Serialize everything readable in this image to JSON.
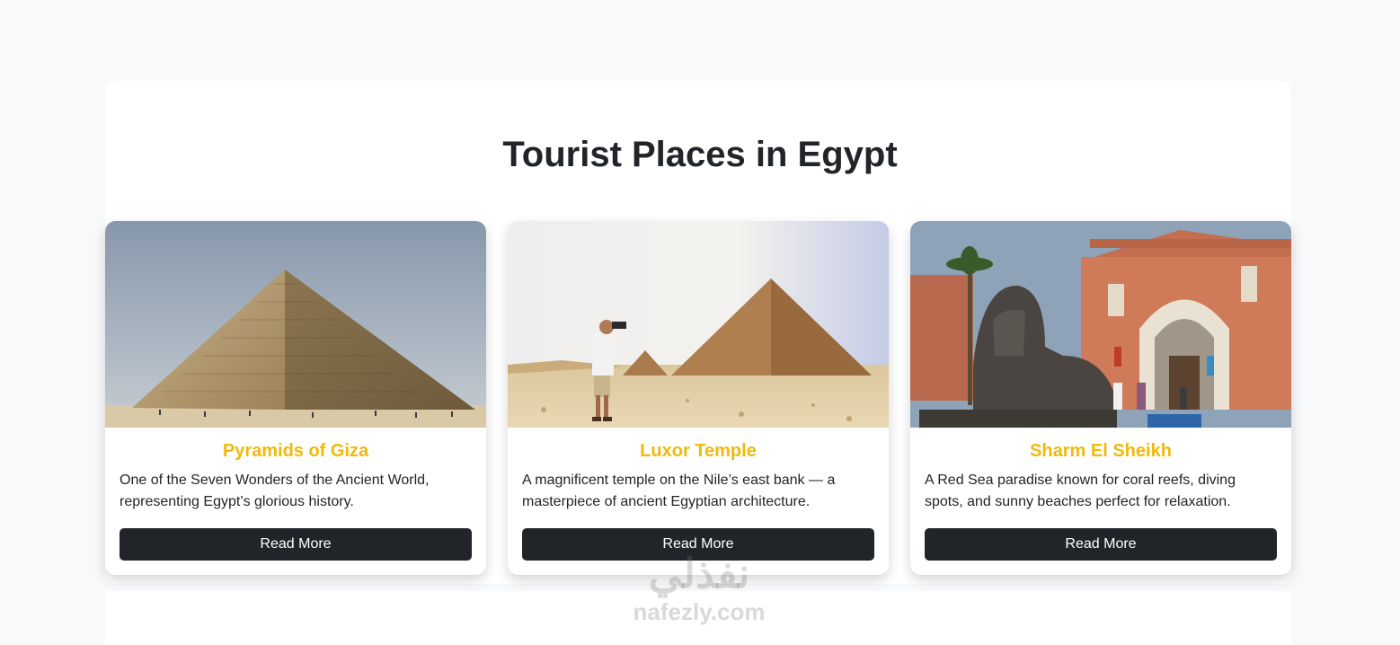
{
  "page": {
    "title": "Tourist Places in Egypt"
  },
  "cards": [
    {
      "title": "Pyramids of Giza",
      "description": "One of the Seven Wonders of the Ancient World, representing Egypt’s glorious history.",
      "button_label": "Read More",
      "image": "great-pyramid-photo"
    },
    {
      "title": "Luxor Temple",
      "description": "A magnificent temple on the Nile’s east bank — a masterpiece of ancient Egyptian architecture.",
      "button_label": "Read More",
      "image": "photographer-pyramids-photo"
    },
    {
      "title": "Sharm El Sheikh",
      "description": "A Red Sea paradise known for coral reefs, diving spots, and sunny beaches perfect for relaxation.",
      "button_label": "Read More",
      "image": "egyptian-museum-sphinx-photo"
    }
  ],
  "watermark": {
    "logo": "نفذلي",
    "url": "nafezly.com"
  },
  "colors": {
    "accent": "#f0b90b",
    "button": "#212529",
    "background": "#f8f9fa"
  }
}
